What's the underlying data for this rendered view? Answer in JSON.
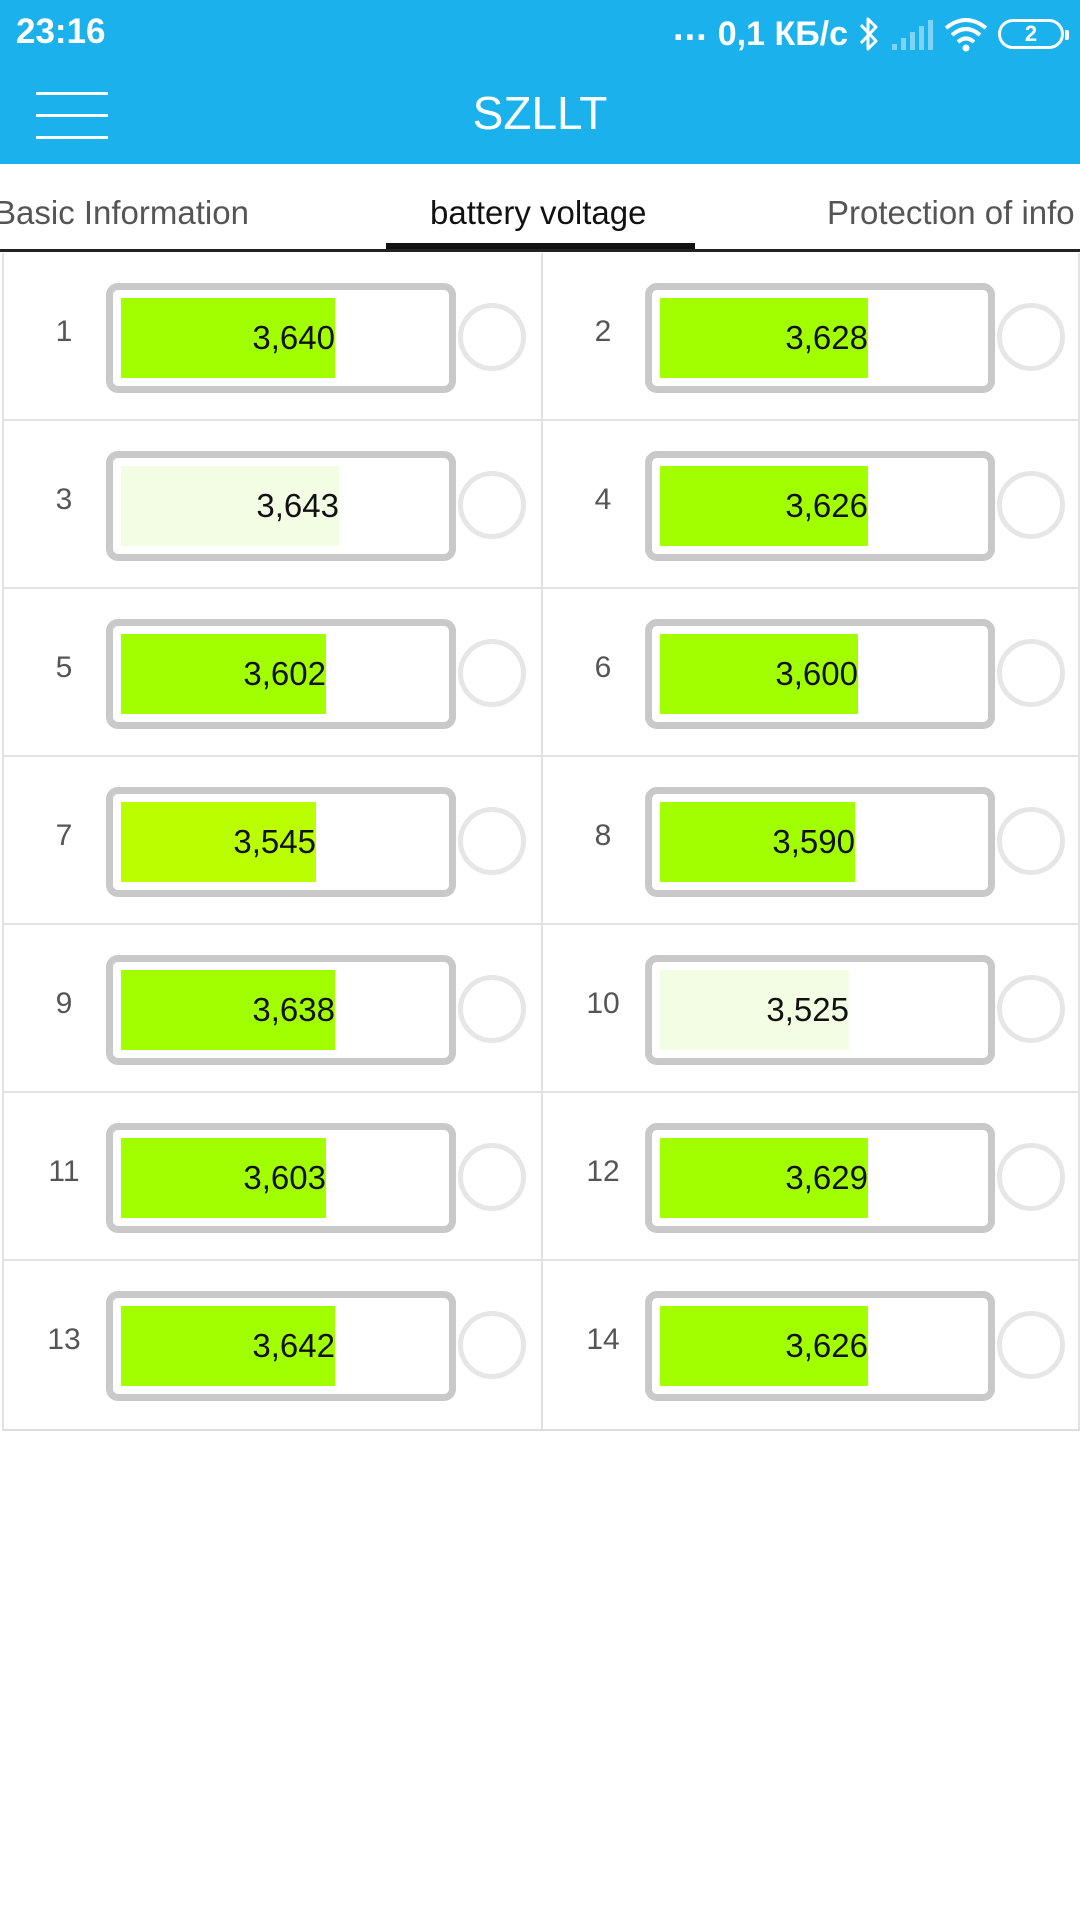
{
  "status_bar": {
    "time": "23:16",
    "dots": "...",
    "network_speed": "0,1 КБ/с",
    "battery_level": "2",
    "icons": [
      "bluetooth-icon",
      "cellular-signal-icon",
      "wifi-icon",
      "battery-icon"
    ]
  },
  "header": {
    "title": "SZLLT",
    "menu_icon": "hamburger-menu-icon",
    "background_color": "#1ab1ec"
  },
  "tabs": [
    {
      "label": "Basic Information",
      "active": false
    },
    {
      "label": "battery voltage",
      "active": true
    },
    {
      "label": "Protection of info",
      "active": false
    }
  ],
  "cells": [
    {
      "index": "1",
      "value": "3,640",
      "level": 0.67,
      "color": "#a1ff00"
    },
    {
      "index": "2",
      "value": "3,628",
      "level": 0.65,
      "color": "#a1ff00"
    },
    {
      "index": "3",
      "value": "3,643",
      "level": 0.68,
      "color": "#f3fde4"
    },
    {
      "index": "4",
      "value": "3,626",
      "level": 0.65,
      "color": "#a1ff00"
    },
    {
      "index": "5",
      "value": "3,602",
      "level": 0.64,
      "color": "#a1ff00"
    },
    {
      "index": "6",
      "value": "3,600",
      "level": 0.62,
      "color": "#a1ff00"
    },
    {
      "index": "7",
      "value": "3,545",
      "level": 0.61,
      "color": "#b9ff00"
    },
    {
      "index": "8",
      "value": "3,590",
      "level": 0.61,
      "color": "#a1ff00"
    },
    {
      "index": "9",
      "value": "3,638",
      "level": 0.67,
      "color": "#a1ff00"
    },
    {
      "index": "10",
      "value": "3,525",
      "level": 0.59,
      "color": "#f3fde4"
    },
    {
      "index": "11",
      "value": "3,603",
      "level": 0.64,
      "color": "#a1ff00"
    },
    {
      "index": "12",
      "value": "3,629",
      "level": 0.65,
      "color": "#a1ff00"
    },
    {
      "index": "13",
      "value": "3,642",
      "level": 0.67,
      "color": "#a1ff00"
    },
    {
      "index": "14",
      "value": "3,626",
      "level": 0.65,
      "color": "#a1ff00"
    }
  ]
}
